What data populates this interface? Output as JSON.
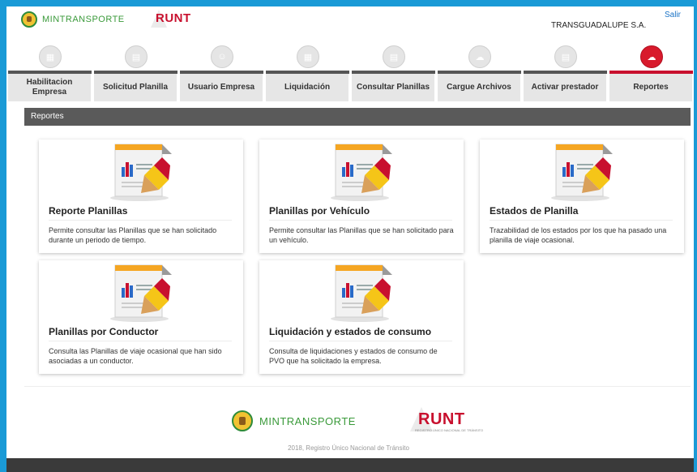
{
  "header": {
    "brand_left": "MINTRANSPORTE",
    "brand_right": "RUNT",
    "brand_right_sub": "REGISTRO ÚNICO NACIONAL DE TRÁNSITO",
    "company": "TRANSGUADALUPE S.A.",
    "logout": "Salir"
  },
  "nav": {
    "items": [
      {
        "label": "Habilitacion Empresa",
        "icon": "building-icon",
        "active": false
      },
      {
        "label": "Solicitud Planilla",
        "icon": "document-icon",
        "active": false
      },
      {
        "label": "Usuario Empresa",
        "icon": "user-icon",
        "active": false
      },
      {
        "label": "Liquidación",
        "icon": "calculator-icon",
        "active": false
      },
      {
        "label": "Consultar Planillas",
        "icon": "document-search-icon",
        "active": false
      },
      {
        "label": "Cargue Archivos",
        "icon": "cloud-upload-icon",
        "active": false
      },
      {
        "label": "Activar prestador",
        "icon": "document-icon",
        "active": false
      },
      {
        "label": "Reportes",
        "icon": "cloud-upload-icon",
        "active": true
      }
    ],
    "active_color": "#d81a2c"
  },
  "section": {
    "title": "Reportes"
  },
  "cards": [
    {
      "title": "Reporte Planillas",
      "description": "Permite consultar las Planillas que se han solicitado durante un periodo de tiempo.",
      "icon": "report-chart-icon"
    },
    {
      "title": "Planillas por Vehículo",
      "description": "Permite consultar las Planillas que se han solicitado para un vehículo.",
      "icon": "report-chart-icon"
    },
    {
      "title": "Estados de Planilla",
      "description": "Trazabilidad de los estados por los que ha pasado una planilla de viaje ocasional.",
      "icon": "report-chart-icon"
    },
    {
      "title": "Planillas por Conductor",
      "description": "Consulta las Planillas de viaje ocasional que han sido asociadas a un conductor.",
      "icon": "report-chart-icon"
    },
    {
      "title": "Liquidación y estados de consumo",
      "description": "Consulta de liquidaciones y estados de consumo de PVO que ha solicitado la empresa.",
      "icon": "report-chart-icon"
    }
  ],
  "footer": {
    "brand_left": "MINTRANSPORTE",
    "brand_right": "RUNT",
    "brand_right_sub": "REGISTRO ÚNICO NACIONAL DE TRÁNSITO",
    "copyright": "2018, Registro Único Nacional de Tránsito"
  },
  "colors": {
    "frame": "#1a9ad6",
    "brand_green": "#3a9a3a",
    "brand_red": "#c8102e",
    "section_bar": "#5a5a5a"
  }
}
